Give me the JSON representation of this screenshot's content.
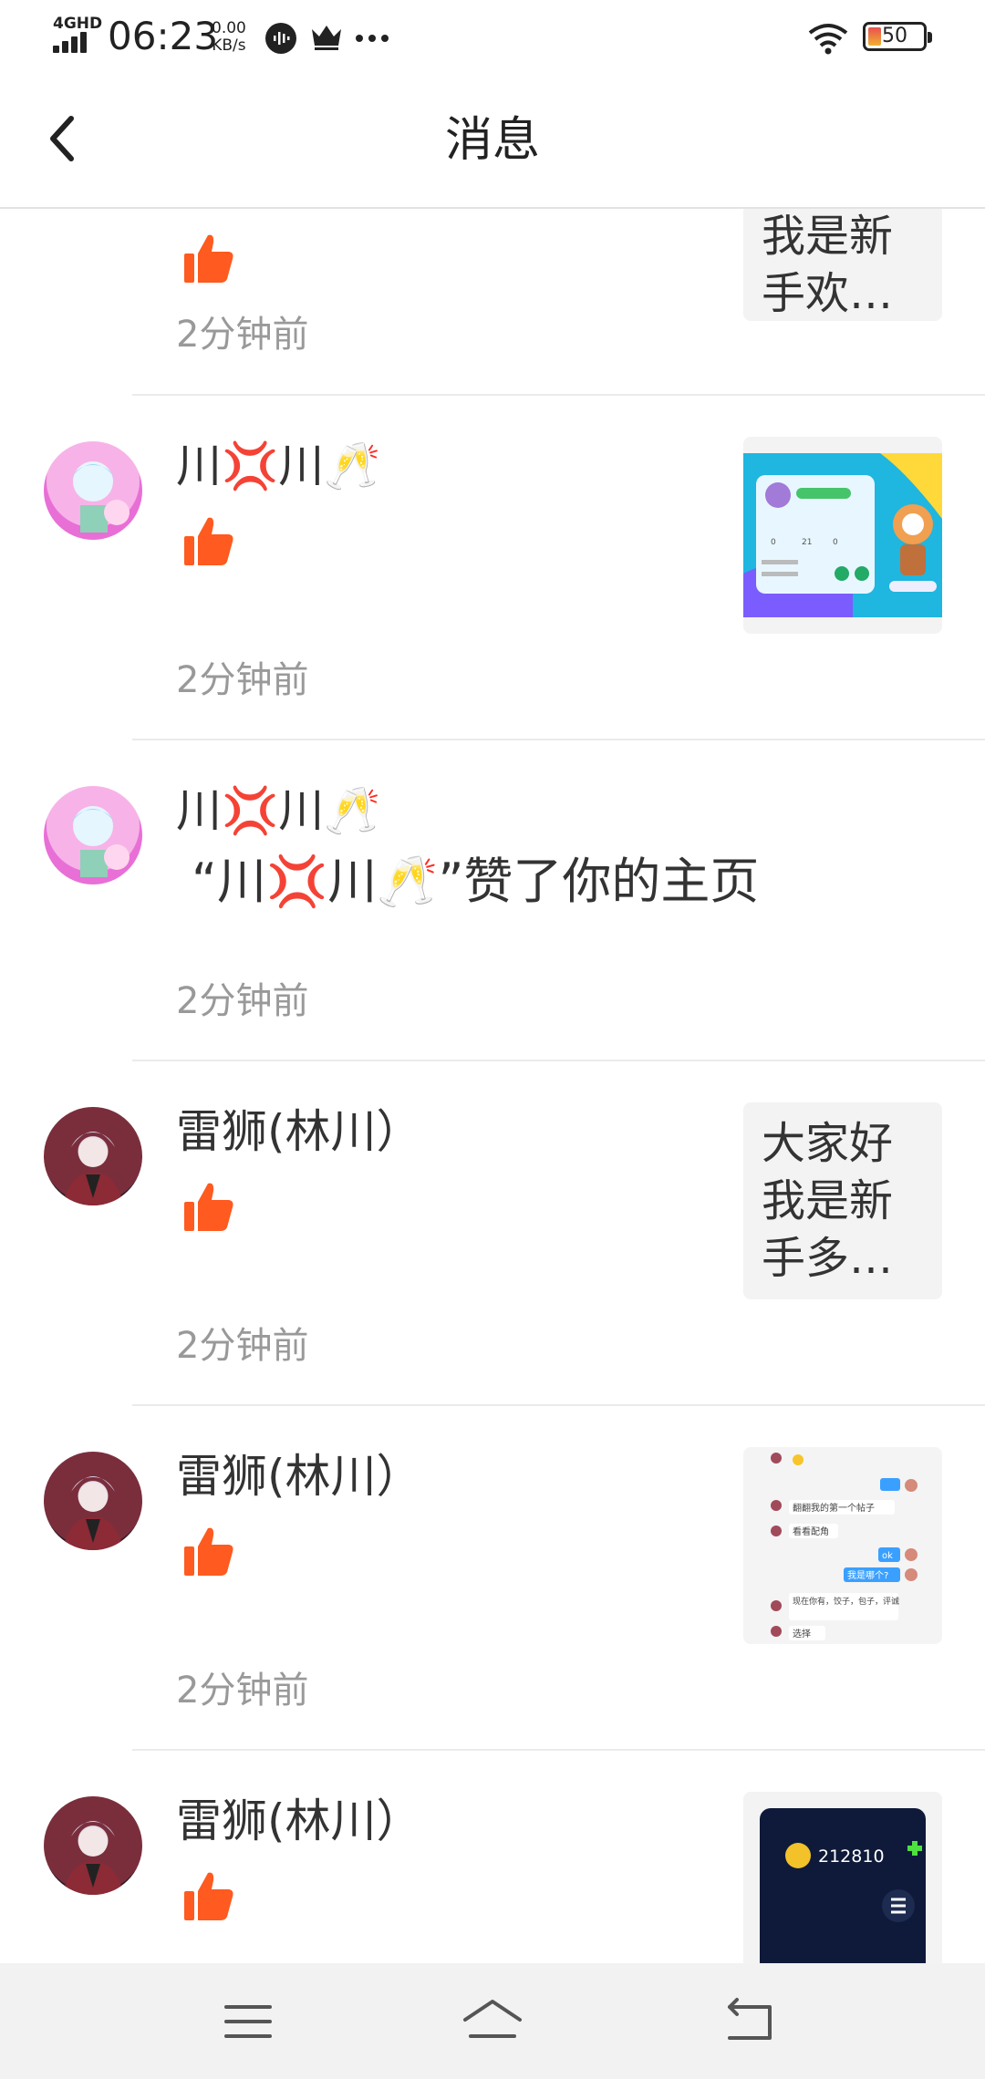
{
  "status_bar": {
    "network": "4GHD",
    "time": "06:23",
    "speed_value": "0.00",
    "speed_unit": "KB/s",
    "battery": "50"
  },
  "header": {
    "title": "消息"
  },
  "items": [
    {
      "time": "2分钟前",
      "preview_text": "我是新手欢…"
    },
    {
      "username": "川💢川🥂",
      "time": "2分钟前",
      "preview": "image"
    },
    {
      "username": "川💢川🥂",
      "action": "“川💢川🥂”赞了你的主页",
      "time": "2分钟前"
    },
    {
      "username": "雷狮(林川）",
      "time": "2分钟前",
      "preview_text": "大家好我是新手多…"
    },
    {
      "username": "雷狮(林川）",
      "time": "2分钟前",
      "preview": "chat screenshot",
      "chat": [
        "翻翻我的第一个帖子",
        "看看配角",
        "ok",
        "我是哪个?",
        "现在你有，饺子，包子，评诚",
        "选择"
      ]
    },
    {
      "username": "雷狮(林川）",
      "preview": "game screenshot",
      "coins": "212810"
    }
  ],
  "thumb_game": {
    "stats": [
      "0",
      "21",
      "0"
    ]
  },
  "colors": {
    "like": "#ff5a1f",
    "time_text": "#999999",
    "preview_bg": "#f3f3f3"
  },
  "icons": [
    "back-icon",
    "thumbs-up-icon",
    "menu-icon",
    "home-icon",
    "back-nav-icon"
  ]
}
